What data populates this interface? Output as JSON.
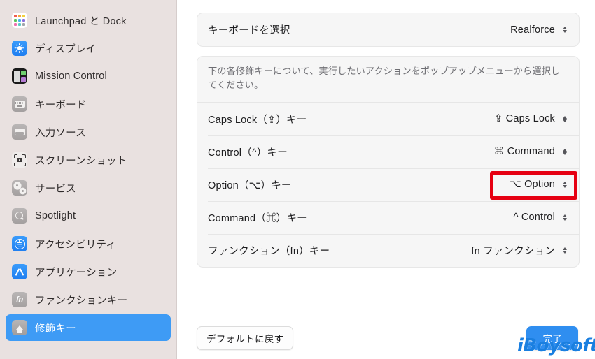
{
  "sidebar": {
    "items": [
      {
        "label": "Launchpad と Dock",
        "icon": "launchpad-icon",
        "selected": false
      },
      {
        "label": "ディスプレイ",
        "icon": "display-icon",
        "selected": false
      },
      {
        "label": "Mission Control",
        "icon": "mission-control-icon",
        "selected": false
      },
      {
        "label": "キーボード",
        "icon": "keyboard-icon",
        "selected": false
      },
      {
        "label": "入力ソース",
        "icon": "input-sources-icon",
        "selected": false
      },
      {
        "label": "スクリーンショット",
        "icon": "screenshot-icon",
        "selected": false
      },
      {
        "label": "サービス",
        "icon": "services-icon",
        "selected": false
      },
      {
        "label": "Spotlight",
        "icon": "spotlight-icon",
        "selected": false
      },
      {
        "label": "アクセシビリティ",
        "icon": "accessibility-icon",
        "selected": false
      },
      {
        "label": "アプリケーション",
        "icon": "applications-icon",
        "selected": false
      },
      {
        "label": "ファンクションキー",
        "icon": "function-keys-icon",
        "selected": false
      },
      {
        "label": "修飾キー",
        "icon": "modifier-keys-icon",
        "selected": true
      }
    ]
  },
  "main": {
    "keyboard_select": {
      "label": "キーボードを選択",
      "value": "Realforce"
    },
    "description": "下の各修飾キーについて、実行したいアクションをポップアップメニューから選択してください。",
    "modifier_rows": [
      {
        "label": "Caps Lock（⇪）キー",
        "value": "⇪ Caps Lock",
        "highlighted": false
      },
      {
        "label": "Control（^）キー",
        "value": "⌘ Command",
        "highlighted": false
      },
      {
        "label": "Option（⌥）キー",
        "value": "⌥ Option",
        "highlighted": true
      },
      {
        "label": "Command（⌘）キー",
        "value": "^ Control",
        "highlighted": false
      },
      {
        "label": "ファンクション（fn）キー",
        "value": "fn ファンクション",
        "highlighted": false
      }
    ]
  },
  "footer": {
    "reset_label": "デフォルトに戻す",
    "done_label": "完了"
  },
  "annotation": {
    "color": "#e60012"
  },
  "watermark": {
    "text": "iBoysoft",
    "color": "#1a7fe0"
  },
  "colors": {
    "sidebar_bg": "#e9e1e0",
    "selection_blue": "#3e9bf5",
    "card_bg": "#f6f6f6",
    "primary_button": "#2f8ef0"
  }
}
